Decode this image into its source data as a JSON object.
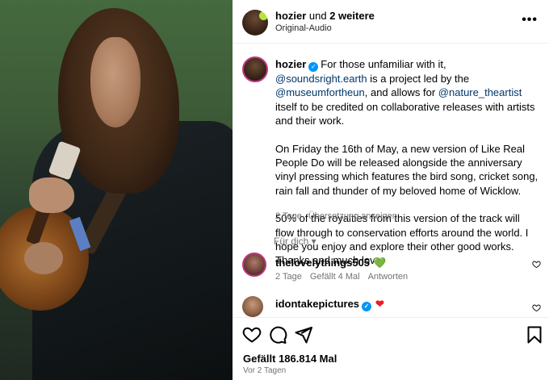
{
  "header": {
    "username": "hozier",
    "connector": " und ",
    "others": "2 weitere",
    "audio": "Original-Audio",
    "more_label": "•••"
  },
  "caption": {
    "username": "hozier",
    "verified_glyph": "✓",
    "p1_a": "For those unfamiliar with it, ",
    "p1_mention1": "@soundsright.earth",
    "p1_b": " is a project led by the ",
    "p1_mention2": "@museumfortheun",
    "p1_c": ", and allows for ",
    "p1_mention3": "@nature_theartist",
    "p1_d": " itself to be credited on collaborative releases with artists and their work.",
    "p2": "On Friday the 16th of May, a new version of Like Real People Do will be released alongside the anniversary vinyl pressing which features the bird song, cricket song, rain fall and thunder of my beloved home of Wicklow.",
    "p3": "50% of the royalties from this version of the track will flow through to conservation efforts around the world. I hope you enjoy and explore their other good works. Thanks and much love.",
    "time": "2 Tage",
    "translate": "Übersetzung anzeigen"
  },
  "for_you": "Für dich ▾",
  "comments": [
    {
      "username": "thelovelythings505",
      "emoji": "💚",
      "time": "2 Tage",
      "likes": "Gefällt 4 Mal",
      "reply": "Antworten"
    },
    {
      "username": "idontakepictures",
      "verified_glyph": "✓",
      "emoji": "❤"
    }
  ],
  "footer": {
    "likes": "Gefällt 186.814 Mal",
    "ago": "Vor 2 Tagen"
  },
  "icons": {
    "like": "heart-outline",
    "comment": "speech-bubble",
    "share": "paper-plane",
    "save": "bookmark"
  },
  "colors": {
    "link": "#00376b",
    "muted": "#737373",
    "verified": "#0095f6",
    "green_heart": "#2ec92e",
    "red_heart": "#ed1c24"
  }
}
